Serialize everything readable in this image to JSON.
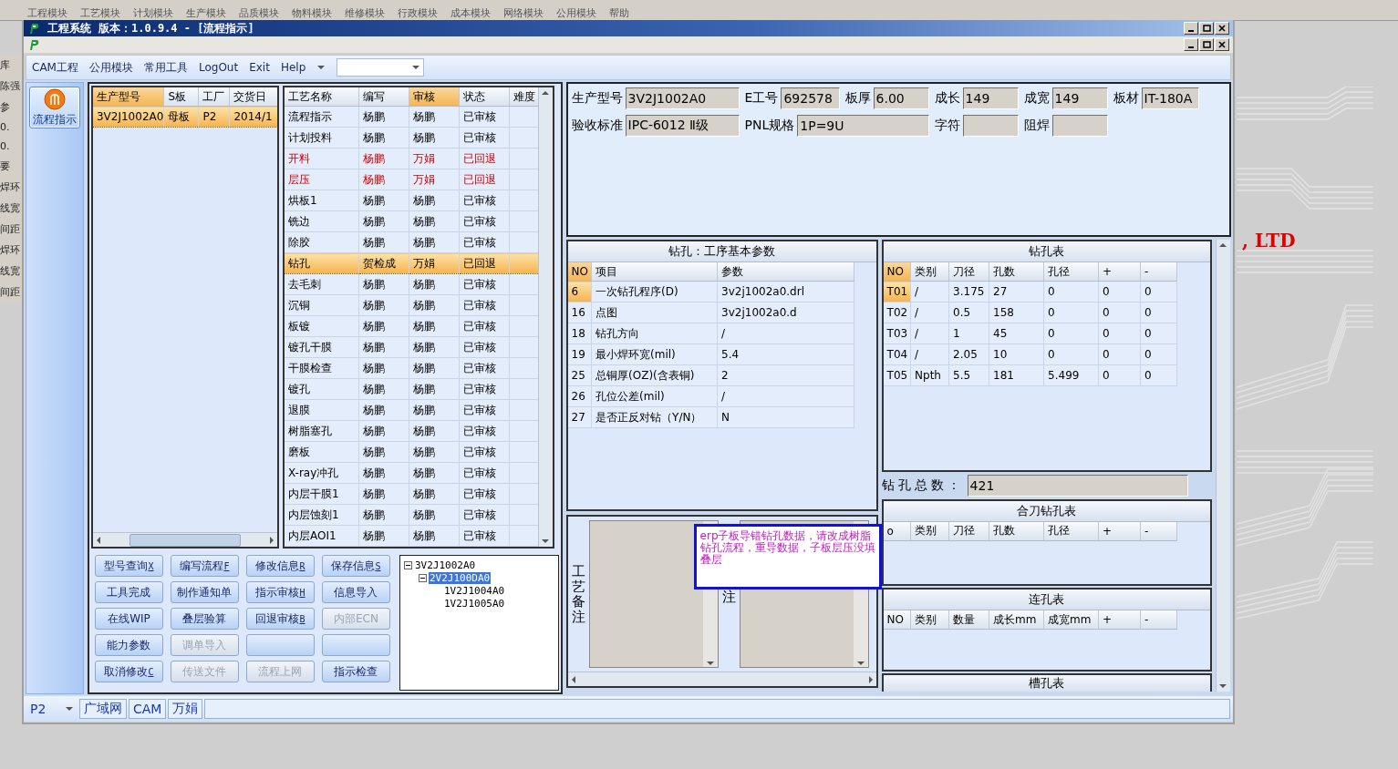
{
  "background_app": {
    "menu": [
      "工程模块",
      "工艺模块",
      "计划模块",
      "生产模块",
      "品质模块",
      "物料模块",
      "维修模块",
      "行政模块",
      "成本模块",
      "网络模块",
      "公用模块",
      "帮助"
    ],
    "side_fragments": [
      "库",
      "陈强",
      "参",
      "0.",
      "0.",
      "要",
      "焊环",
      "线宽",
      "间距",
      "焊环",
      "线宽",
      "间距"
    ],
    "logo_text": ", LTD"
  },
  "window": {
    "title": "工程系统",
    "version": "版本：1.0.9.4 - [流程指示]"
  },
  "menu": [
    "CAM工程",
    "公用模块",
    "常用工具",
    "LogOut",
    "Exit",
    "Help"
  ],
  "nav": [
    {
      "label": "流程指示",
      "selected": true
    }
  ],
  "product_list": {
    "columns": [
      "生产型号",
      "S板",
      "工厂",
      "交货日"
    ],
    "rows": [
      {
        "cells": [
          "3V2J1002A0",
          "母板",
          "P2",
          "2014/1"
        ],
        "selected": true
      }
    ]
  },
  "process_table": {
    "columns": [
      {
        "label": "工艺名称",
        "sorted": false
      },
      {
        "label": "编写",
        "sorted": false
      },
      {
        "label": "审核",
        "sorted": true
      },
      {
        "label": "状态",
        "sorted": false
      },
      {
        "label": "难度",
        "sorted": false
      }
    ],
    "rows": [
      {
        "name": "流程指示",
        "author": "杨鹏",
        "reviewer": "杨鹏",
        "status": "已审核",
        "alert": false,
        "selected": false
      },
      {
        "name": "计划投料",
        "author": "杨鹏",
        "reviewer": "杨鹏",
        "status": "已审核",
        "alert": false,
        "selected": false
      },
      {
        "name": "开料",
        "author": "杨鹏",
        "reviewer": "万娟",
        "status": "已回退",
        "alert": true,
        "selected": false
      },
      {
        "name": "层压",
        "author": "杨鹏",
        "reviewer": "万娟",
        "status": "已回退",
        "alert": true,
        "selected": false
      },
      {
        "name": "烘板1",
        "author": "杨鹏",
        "reviewer": "杨鹏",
        "status": "已审核",
        "alert": false,
        "selected": false
      },
      {
        "name": "铣边",
        "author": "杨鹏",
        "reviewer": "杨鹏",
        "status": "已审核",
        "alert": false,
        "selected": false
      },
      {
        "name": "除胶",
        "author": "杨鹏",
        "reviewer": "杨鹏",
        "status": "已审核",
        "alert": false,
        "selected": false
      },
      {
        "name": "钻孔",
        "author": "贺检成",
        "reviewer": "万娟",
        "status": "已回退",
        "alert": false,
        "selected": true
      },
      {
        "name": "去毛刺",
        "author": "杨鹏",
        "reviewer": "杨鹏",
        "status": "已审核",
        "alert": false,
        "selected": false
      },
      {
        "name": "沉铜",
        "author": "杨鹏",
        "reviewer": "杨鹏",
        "status": "已审核",
        "alert": false,
        "selected": false
      },
      {
        "name": "板镀",
        "author": "杨鹏",
        "reviewer": "杨鹏",
        "status": "已审核",
        "alert": false,
        "selected": false
      },
      {
        "name": "镀孔干膜",
        "author": "杨鹏",
        "reviewer": "杨鹏",
        "status": "已审核",
        "alert": false,
        "selected": false
      },
      {
        "name": "干膜检查",
        "author": "杨鹏",
        "reviewer": "杨鹏",
        "status": "已审核",
        "alert": false,
        "selected": false
      },
      {
        "name": "镀孔",
        "author": "杨鹏",
        "reviewer": "杨鹏",
        "status": "已审核",
        "alert": false,
        "selected": false
      },
      {
        "name": "退膜",
        "author": "杨鹏",
        "reviewer": "杨鹏",
        "status": "已审核",
        "alert": false,
        "selected": false
      },
      {
        "name": "树脂塞孔",
        "author": "杨鹏",
        "reviewer": "杨鹏",
        "status": "已审核",
        "alert": false,
        "selected": false
      },
      {
        "name": "磨板",
        "author": "杨鹏",
        "reviewer": "杨鹏",
        "status": "已审核",
        "alert": false,
        "selected": false
      },
      {
        "name": "X-ray冲孔",
        "author": "杨鹏",
        "reviewer": "杨鹏",
        "status": "已审核",
        "alert": false,
        "selected": false
      },
      {
        "name": "内层干膜1",
        "author": "杨鹏",
        "reviewer": "杨鹏",
        "status": "已审核",
        "alert": false,
        "selected": false
      },
      {
        "name": "内层蚀刻1",
        "author": "杨鹏",
        "reviewer": "杨鹏",
        "status": "已审核",
        "alert": false,
        "selected": false
      },
      {
        "name": "内层AOI1",
        "author": "杨鹏",
        "reviewer": "杨鹏",
        "status": "已审核",
        "alert": false,
        "selected": false
      }
    ]
  },
  "buttons": [
    {
      "label": "型号查询",
      "key": "X",
      "disabled": false
    },
    {
      "label": "编写流程",
      "key": "F",
      "disabled": false
    },
    {
      "label": "修改信息",
      "key": "R",
      "disabled": false
    },
    {
      "label": "保存信息",
      "key": "S",
      "disabled": false
    },
    {
      "label": "工具完成",
      "disabled": false
    },
    {
      "label": "制作通知单",
      "disabled": false
    },
    {
      "label": "指示审核",
      "key": "H",
      "disabled": false
    },
    {
      "label": "信息导入",
      "disabled": false
    },
    {
      "label": "在线WIP",
      "disabled": false
    },
    {
      "label": "叠层验算",
      "disabled": false
    },
    {
      "label": "回退审核",
      "key": "B",
      "disabled": false
    },
    {
      "label": "内部ECN",
      "disabled": true
    },
    {
      "label": "能力参数",
      "disabled": false
    },
    {
      "label": "调单导入",
      "disabled": true
    },
    {
      "disabled": false
    },
    {
      "disabled": false
    },
    {
      "label": "取消修改",
      "key": "C",
      "disabled": false
    },
    {
      "label": "传送文件",
      "disabled": true
    },
    {
      "label": "流程上网",
      "disabled": true
    },
    {
      "label": "指示检查",
      "disabled": false
    }
  ],
  "tree": [
    {
      "label": "3V2J1002A0",
      "expanded": true,
      "selected": false,
      "children": [
        {
          "label": "2V2J100DA0",
          "expanded": true,
          "selected": true,
          "children": [
            {
              "label": "1V2J1004A0",
              "selected": false
            },
            {
              "label": "1V2J1005A0",
              "selected": false
            }
          ]
        }
      ]
    }
  ],
  "info_fields": [
    [
      {
        "label": "生产型号",
        "value": "3V2J1002A0"
      },
      {
        "label": "E工号",
        "value": "692578"
      },
      {
        "label": "板厚",
        "value": "6.00"
      },
      {
        "label": "成长",
        "value": "149"
      },
      {
        "label": "成宽",
        "value": "149"
      },
      {
        "label": "板材",
        "value": "IT-180A"
      }
    ],
    [
      {
        "label": "验收标准",
        "value": "IPC-6012 Ⅱ级"
      },
      {
        "label": "PNL规格",
        "value": "1P=9U"
      },
      {
        "label": "字符"
      },
      {
        "label": "阻焊"
      }
    ]
  ],
  "params": {
    "title": "钻孔：工序基本参数",
    "columns": [
      "NO",
      "项目",
      "参数"
    ],
    "rows": [
      {
        "no": "6",
        "item": "一次钻孔程序(D)",
        "value": "3v2j1002a0.drl",
        "current": true
      },
      {
        "no": "16",
        "item": "点图",
        "value": "3v2j1002a0.d",
        "current": false
      },
      {
        "no": "18",
        "item": "钻孔方向",
        "value": "/",
        "current": false
      },
      {
        "no": "19",
        "item": "最小焊环宽(mil)",
        "value": "5.4",
        "current": false
      },
      {
        "no": "25",
        "item": "总铜厚(OZ)(含表铜)",
        "value": "2",
        "current": false
      },
      {
        "no": "26",
        "item": "孔位公差(mil)",
        "value": "/",
        "current": false
      },
      {
        "no": "27",
        "item": "是否正反对钻（Y/N）",
        "value": "N",
        "current": false
      }
    ]
  },
  "remarks": {
    "process_label": "工艺备注",
    "note_label": "注"
  },
  "popup": {
    "text": "erp子板导错钻孔数据，请改成树脂钻孔流程，重导数据，子板层压没填叠层"
  },
  "drill_table": {
    "title": "钻孔表",
    "columns": [
      "NO",
      "类别",
      "刀径",
      "孔数",
      "孔径",
      "+",
      "-"
    ],
    "rows": [
      {
        "cells": [
          "T01",
          "/",
          "3.175",
          "27",
          "0",
          "0",
          "0"
        ],
        "current": true
      },
      {
        "cells": [
          "T02",
          "/",
          "0.5",
          "158",
          "0",
          "0",
          "0"
        ],
        "current": false
      },
      {
        "cells": [
          "T03",
          "/",
          "1",
          "45",
          "0",
          "0",
          "0"
        ],
        "current": false
      },
      {
        "cells": [
          "T04",
          "/",
          "2.05",
          "10",
          "0",
          "0",
          "0"
        ],
        "current": false
      },
      {
        "cells": [
          "T05",
          "Npth",
          "5.5",
          "181",
          "5.499",
          "0",
          "0"
        ],
        "current": false
      }
    ]
  },
  "drill_total": {
    "label": "钻孔总数：",
    "value": "421"
  },
  "combined_table": {
    "title": "合刀钻孔表",
    "columns": [
      "o",
      "类别",
      "刀径",
      "孔数",
      "孔径",
      "+",
      "-"
    ]
  },
  "linked_table": {
    "title": "连孔表",
    "columns": [
      "NO",
      "类别",
      "数量",
      "成长mm",
      "成宽mm",
      "+",
      "-"
    ]
  },
  "slot_table": {
    "title": "槽孔表"
  },
  "status_bar": {
    "factory": "P2",
    "panels": [
      "广域网",
      "CAM",
      "万娟"
    ]
  }
}
